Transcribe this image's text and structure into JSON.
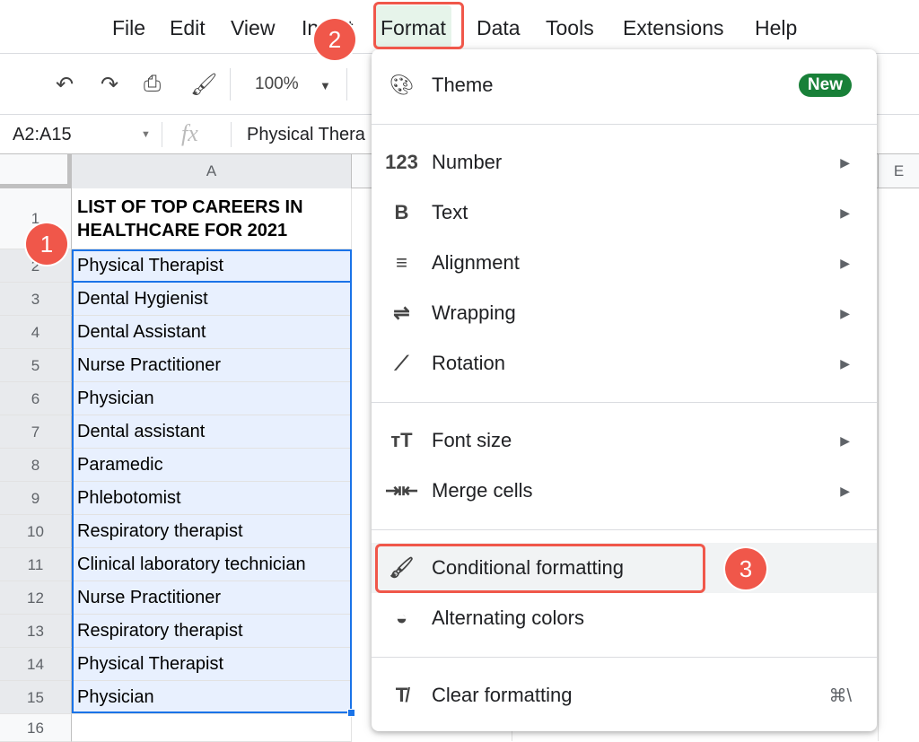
{
  "menubar": {
    "items": [
      "File",
      "Edit",
      "View",
      "Insert",
      "Format",
      "Data",
      "Tools",
      "Extensions",
      "Help"
    ]
  },
  "toolbar": {
    "zoom": "100%"
  },
  "formula_bar": {
    "name_box": "A2:A15",
    "fx": "fx",
    "value": "Physical Thera"
  },
  "columns": [
    "A",
    "E"
  ],
  "rows": [
    {
      "n": "1",
      "v": "LIST OF TOP CAREERS IN HEALTHCARE FOR 2021"
    },
    {
      "n": "2",
      "v": "Physical Therapist"
    },
    {
      "n": "3",
      "v": "Dental Hygienist"
    },
    {
      "n": "4",
      "v": "Dental Assistant"
    },
    {
      "n": "5",
      "v": "Nurse Practitioner"
    },
    {
      "n": "6",
      "v": "Physician"
    },
    {
      "n": "7",
      "v": "Dental assistant"
    },
    {
      "n": "8",
      "v": "Paramedic"
    },
    {
      "n": "9",
      "v": "Phlebotomist"
    },
    {
      "n": "10",
      "v": "Respiratory therapist"
    },
    {
      "n": "11",
      "v": "Clinical laboratory technician"
    },
    {
      "n": "12",
      "v": "Nurse Practitioner"
    },
    {
      "n": "13",
      "v": "Respiratory therapist"
    },
    {
      "n": "14",
      "v": "Physical Therapist"
    },
    {
      "n": "15",
      "v": "Physician"
    },
    {
      "n": "16",
      "v": ""
    }
  ],
  "format_menu": {
    "theme": {
      "label": "Theme",
      "badge": "New",
      "icon": "palette-icon"
    },
    "items": [
      {
        "label": "Number",
        "icon": "123-icon",
        "glyph": "123"
      },
      {
        "label": "Text",
        "icon": "bold-icon",
        "glyph": "B"
      },
      {
        "label": "Alignment",
        "icon": "align-icon",
        "glyph": "≡"
      },
      {
        "label": "Wrapping",
        "icon": "wrap-icon",
        "glyph": "⇌"
      },
      {
        "label": "Rotation",
        "icon": "rotation-icon",
        "glyph": "⟋"
      },
      {
        "label": "Font size",
        "icon": "font-size-icon",
        "glyph": "тT"
      },
      {
        "label": "Merge cells",
        "icon": "merge-icon",
        "glyph": "⇥⇤"
      }
    ],
    "conditional": {
      "label": "Conditional formatting",
      "glyph": "🖌"
    },
    "alternating": {
      "label": "Alternating colors",
      "glyph": "◒"
    },
    "clear": {
      "label": "Clear formatting",
      "shortcut": "⌘\\",
      "glyph": "T̸"
    }
  },
  "annotations": [
    "1",
    "2",
    "3"
  ],
  "colors": {
    "accent": "#f0574a",
    "selection": "#e8f0fe",
    "badge": "#188038"
  }
}
